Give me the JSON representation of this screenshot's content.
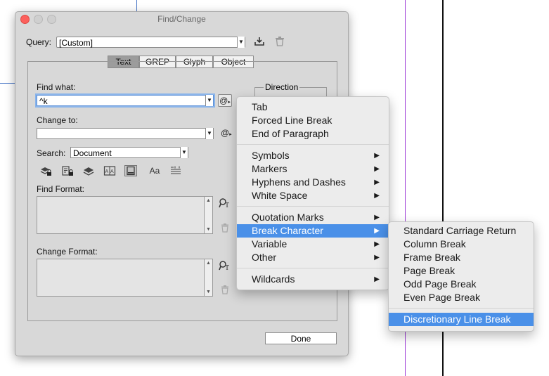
{
  "window": {
    "title": "Find/Change"
  },
  "query": {
    "label": "Query:",
    "value": "[Custom]"
  },
  "tabs": [
    "Text",
    "GREP",
    "Glyph",
    "Object"
  ],
  "find_what": {
    "label": "Find what:",
    "value": "^k"
  },
  "change_to": {
    "label": "Change to:",
    "value": ""
  },
  "search": {
    "label": "Search:",
    "value": "Document"
  },
  "direction": {
    "label": "Direction"
  },
  "find_format": {
    "label": "Find Format:"
  },
  "change_format": {
    "label": "Change Format:"
  },
  "done_label": "Done",
  "special_char_menu": {
    "groups": [
      [
        "Tab",
        "Forced Line Break",
        "End of Paragraph"
      ],
      [
        "Symbols",
        "Markers",
        "Hyphens and Dashes",
        "White Space"
      ],
      [
        "Quotation Marks",
        "Break Character",
        "Variable",
        "Other"
      ],
      [
        "Wildcards"
      ]
    ],
    "highlighted": "Break Character"
  },
  "break_character_submenu": {
    "items": [
      "Standard Carriage Return",
      "Column Break",
      "Frame Break",
      "Page Break",
      "Odd Page Break",
      "Even Page Break"
    ],
    "highlighted": "Discretionary Line Break"
  },
  "colors": {
    "highlight": "#4a90e8",
    "close_button": "#fc605c",
    "guide_purple": "#a040d8",
    "guide_blue": "#4a78c8"
  },
  "icons": [
    "save-query-icon",
    "delete-query-icon",
    "special-characters-icon",
    "include-locked-layers-icon",
    "include-locked-stories-icon",
    "include-hidden-layers-icon",
    "include-master-pages-icon",
    "include-footnotes-icon",
    "case-sensitive-icon",
    "whole-word-icon",
    "specify-attributes-icon",
    "clear-attributes-icon"
  ]
}
